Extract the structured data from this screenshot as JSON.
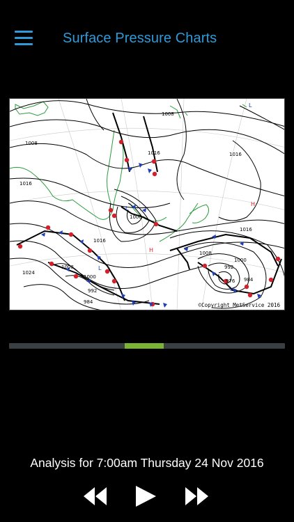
{
  "header": {
    "title": "Surface Pressure Charts",
    "accent_color": "#2f9ad9",
    "menu_icon": "hamburger-menu-icon"
  },
  "map": {
    "isobar_labels": [
      "1008",
      "1008",
      "1016",
      "1016",
      "1016",
      "1016",
      "1000",
      "1008",
      "1000",
      "992",
      "976",
      "984",
      "1024",
      "1008",
      "1000",
      "992",
      "984",
      "1016"
    ],
    "pressure_centers": [
      {
        "label": "L",
        "kind": "low"
      },
      {
        "label": "H",
        "kind": "high"
      },
      {
        "label": "H",
        "kind": "high"
      },
      {
        "label": "L",
        "kind": "low"
      },
      {
        "label": "L",
        "kind": "low"
      },
      {
        "label": "L",
        "kind": "low"
      }
    ],
    "copyright": "©Copyright MetService 2016"
  },
  "timeline": {
    "progress_start": 0.42,
    "progress_end": 0.56,
    "track_color": "#3a3f44",
    "fill_color": "#7bb335"
  },
  "caption": {
    "text": "Analysis for 7:00am Thursday 24 Nov 2016"
  },
  "controls": {
    "rewind_icon": "rewind-icon",
    "play_icon": "play-icon",
    "forward_icon": "fast-forward-icon"
  }
}
